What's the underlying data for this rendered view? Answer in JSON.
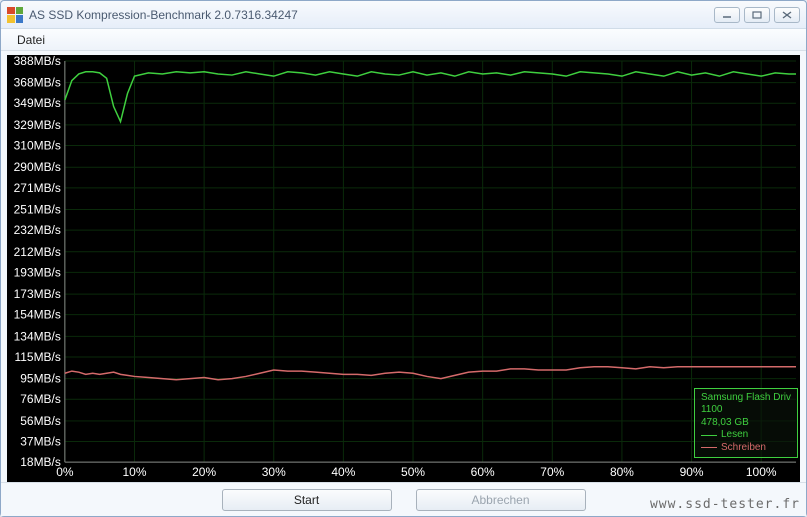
{
  "window": {
    "title": "AS SSD Kompression-Benchmark 2.0.7316.34247"
  },
  "menu": {
    "file": "Datei"
  },
  "buttons": {
    "start": "Start",
    "abort": "Abbrechen"
  },
  "legend": {
    "device": "Samsung Flash Driv",
    "device_line2": "1100",
    "capacity": "478,03 GB",
    "read": "Lesen",
    "write": "Schreiben"
  },
  "watermark": "www.ssd-tester.fr",
  "colors": {
    "read": "#3fcf3f",
    "write": "#d46a6a",
    "grid": "#0a2a0a",
    "axis": "#bfbfbf",
    "bg": "#000000"
  },
  "chart_data": {
    "type": "line",
    "title": "",
    "xlabel": "",
    "ylabel": "",
    "x_unit": "%",
    "y_unit": "MB/s",
    "xlim": [
      0,
      105
    ],
    "ylim": [
      18,
      388
    ],
    "y_ticks": [
      388,
      368,
      349,
      329,
      310,
      290,
      271,
      251,
      232,
      212,
      193,
      173,
      154,
      134,
      115,
      95,
      76,
      56,
      37,
      18
    ],
    "x_ticks": [
      0,
      10,
      20,
      30,
      40,
      50,
      60,
      70,
      80,
      90,
      100
    ],
    "y_tick_suffix": "MB/s",
    "x_tick_suffix": "%",
    "x": [
      0,
      1,
      2,
      3,
      4,
      5,
      6,
      7,
      8,
      9,
      10,
      12,
      14,
      16,
      18,
      20,
      22,
      24,
      26,
      28,
      30,
      32,
      34,
      36,
      38,
      40,
      42,
      44,
      46,
      48,
      50,
      52,
      54,
      56,
      58,
      60,
      62,
      64,
      66,
      68,
      70,
      72,
      74,
      76,
      78,
      80,
      82,
      84,
      86,
      88,
      90,
      92,
      94,
      96,
      98,
      100,
      102,
      104,
      105
    ],
    "series": [
      {
        "name": "Lesen",
        "color": "#3fcf3f",
        "values": [
          352,
          370,
          376,
          378,
          378,
          377,
          372,
          346,
          332,
          358,
          374,
          377,
          376,
          378,
          377,
          378,
          376,
          375,
          378,
          376,
          374,
          378,
          377,
          375,
          378,
          376,
          374,
          378,
          376,
          375,
          378,
          375,
          377,
          374,
          378,
          376,
          377,
          375,
          378,
          377,
          376,
          374,
          378,
          377,
          376,
          374,
          378,
          376,
          374,
          378,
          375,
          377,
          374,
          378,
          376,
          374,
          377,
          376,
          376
        ]
      },
      {
        "name": "Schreiben",
        "color": "#d46a6a",
        "values": [
          100,
          102,
          101,
          99,
          100,
          99,
          100,
          101,
          99,
          98,
          97,
          96,
          95,
          94,
          95,
          96,
          94,
          95,
          97,
          100,
          103,
          102,
          102,
          101,
          100,
          99,
          99,
          98,
          100,
          101,
          100,
          97,
          95,
          98,
          101,
          102,
          102,
          104,
          104,
          103,
          103,
          103,
          105,
          106,
          106,
          105,
          104,
          106,
          105,
          106,
          106,
          106,
          106,
          106,
          106,
          106,
          106,
          106,
          106
        ]
      }
    ]
  }
}
